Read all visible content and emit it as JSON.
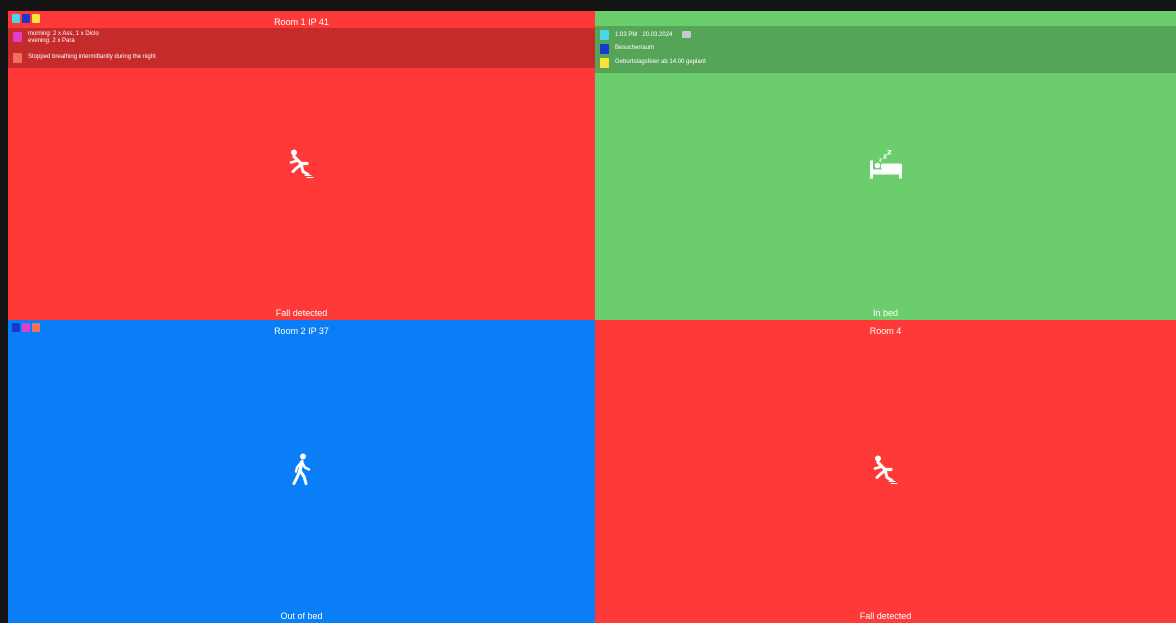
{
  "tiles": [
    {
      "title": "Room 1 IP 41",
      "status": "Fall detected",
      "bg": "#ff3838",
      "chips": [
        "#44d8e8",
        "#1a38d0",
        "#ffe23a"
      ],
      "notes_bg": "#c62b2b",
      "notes": [
        {
          "color": "#e040c8",
          "lines": [
            "morning: 2 x Ass, 1 x Diclo",
            "evening: 2 x Para"
          ]
        },
        {
          "color": "#f07060",
          "lines": [
            "Stopped breathing intermittantly during the night"
          ]
        }
      ],
      "icon": "falling-person-icon"
    },
    {
      "title": "",
      "status": "In bed",
      "bg": "#6ccd6c",
      "chips": [],
      "notes_bg": "#56a457",
      "datetime": {
        "time": "1:03 PM",
        "date": "20.03.2024",
        "color": "#44d8e8"
      },
      "notes": [
        {
          "color": "#1a38d0",
          "lines": [
            "Besucherraum"
          ]
        },
        {
          "color": "#ffe23a",
          "lines": [
            "Geburtstagsfeier ab 14:00 geplant"
          ]
        }
      ],
      "icon": "sleeping-bed-icon"
    },
    {
      "title": "Room 2 IP 37",
      "status": "Out of bed",
      "bg": "#0a7ef6",
      "chips": [
        "#1a38d0",
        "#e040c8",
        "#f07060"
      ],
      "notes": [],
      "icon": "walking-person-icon"
    },
    {
      "title": "Room 4",
      "status": "Fall detected",
      "bg": "#ff3838",
      "chips": [],
      "notes": [],
      "icon": "falling-person-icon"
    }
  ]
}
